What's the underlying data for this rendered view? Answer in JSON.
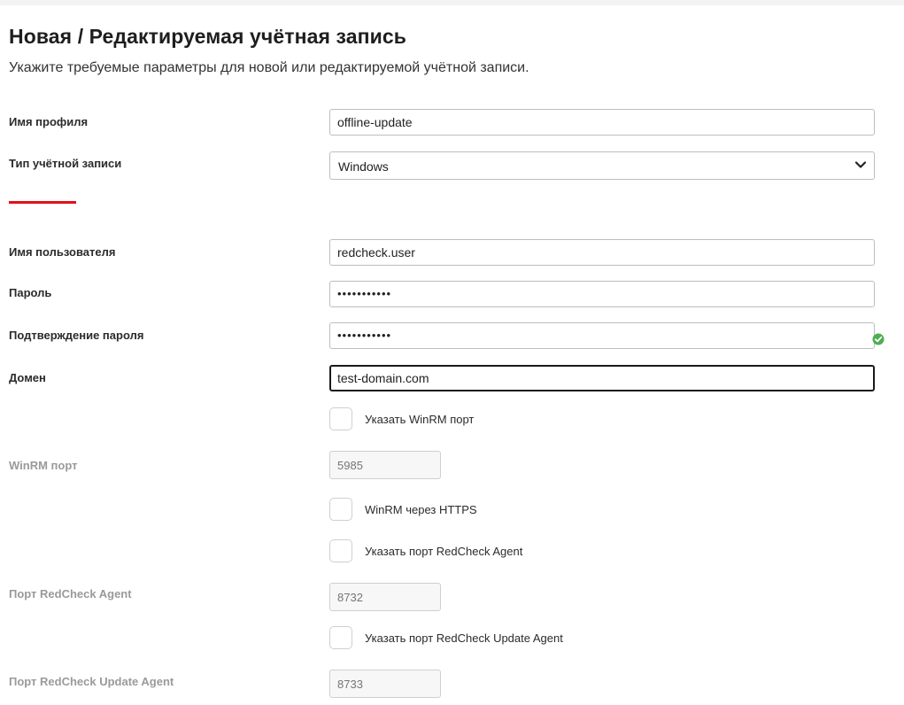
{
  "header": {
    "title": "Новая / Редактируемая учётная запись",
    "subtitle": "Укажите требуемые параметры для новой или редактируемой учётной записи."
  },
  "form": {
    "profile_name": {
      "label": "Имя профиля",
      "value": "offline-update"
    },
    "account_type": {
      "label": "Тип учётной записи",
      "value": "Windows"
    },
    "username": {
      "label": "Имя пользователя",
      "value": "redcheck.user"
    },
    "password": {
      "label": "Пароль",
      "value": "•••••••••••"
    },
    "password_confirm": {
      "label": "Подтверждение пароля",
      "value": "•••••••••••"
    },
    "domain": {
      "label": "Домен",
      "value": "test-domain.com"
    },
    "winrm_port_toggle": {
      "label": "Указать WinRM порт",
      "checked": false
    },
    "winrm_port": {
      "label": "WinRM порт",
      "placeholder": "5985"
    },
    "winrm_https": {
      "label": "WinRM через HTTPS",
      "checked": false
    },
    "agent_port_toggle": {
      "label": "Указать порт RedCheck Agent",
      "checked": false
    },
    "agent_port": {
      "label": "Порт RedCheck Agent",
      "placeholder": "8732"
    },
    "update_agent_port_toggle": {
      "label": "Указать порт RedCheck Update Agent",
      "checked": false
    },
    "update_agent_port": {
      "label": "Порт RedCheck Update Agent",
      "placeholder": "8733"
    }
  },
  "colors": {
    "accent": "#e3101a",
    "success": "#4caf50",
    "disabled_text": "#9a9a9a"
  },
  "icons": {
    "select_arrow": "chevron-down-icon",
    "password_match": "check-circle-icon"
  }
}
